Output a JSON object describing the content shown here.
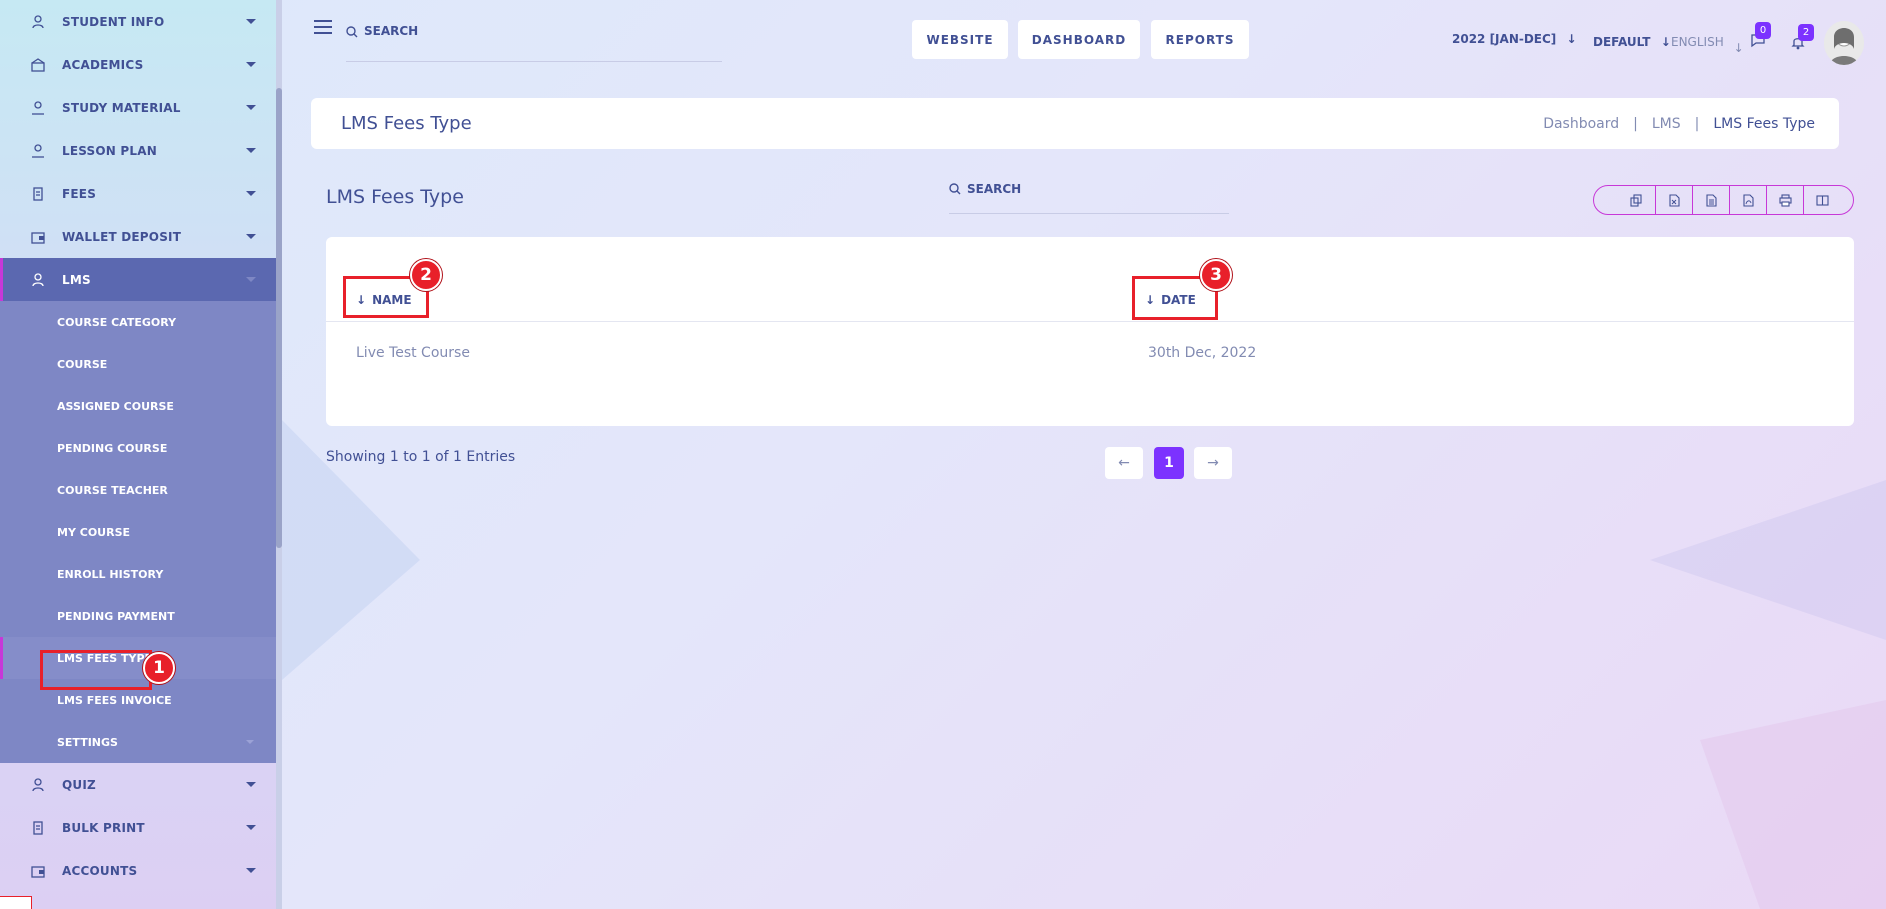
{
  "sidebar": {
    "items_top": [
      {
        "label": "STUDENT INFO",
        "icon": "student-icon"
      },
      {
        "label": "ACADEMICS",
        "icon": "academics-icon"
      },
      {
        "label": "STUDY MATERIAL",
        "icon": "study-icon"
      },
      {
        "label": "LESSON PLAN",
        "icon": "lesson-icon"
      },
      {
        "label": "FEES",
        "icon": "fees-icon"
      },
      {
        "label": "WALLET DEPOSIT",
        "icon": "wallet-icon"
      }
    ],
    "active_item": {
      "label": "LMS",
      "icon": "lms-icon"
    },
    "submenu": [
      "COURSE CATEGORY",
      "COURSE",
      "ASSIGNED COURSE",
      "PENDING COURSE",
      "COURSE TEACHER",
      "MY COURSE",
      "ENROLL HISTORY",
      "PENDING PAYMENT",
      "LMS FEES TYPE",
      "LMS FEES INVOICE",
      "SETTINGS"
    ],
    "items_bottom": [
      {
        "label": "QUIZ",
        "icon": "quiz-icon"
      },
      {
        "label": "BULK PRINT",
        "icon": "print-icon"
      },
      {
        "label": "ACCOUNTS",
        "icon": "accounts-icon"
      }
    ]
  },
  "topbar": {
    "search_placeholder": "SEARCH",
    "buttons": [
      "WEBSITE",
      "DASHBOARD",
      "REPORTS"
    ],
    "session": "2022 [JAN-DEC]",
    "theme": "DEFAULT",
    "language": "ENGLISH",
    "messages_count": "0",
    "notifications_count": "2"
  },
  "page": {
    "title": "LMS Fees Type",
    "breadcrumb": [
      "Dashboard",
      "|",
      "LMS",
      "|",
      "LMS Fees Type"
    ],
    "section_title": "LMS Fees Type",
    "table_search_placeholder": "SEARCH"
  },
  "table": {
    "columns": [
      "NAME",
      "DATE"
    ],
    "rows": [
      {
        "name": "Live Test Course",
        "date": "30th Dec, 2022"
      }
    ]
  },
  "footer": {
    "entries": "Showing 1 to 1 of 1 Entries",
    "prev": "←",
    "current_page": "1",
    "next": "→"
  },
  "markers": [
    "1",
    "2",
    "3"
  ],
  "colors": {
    "accent": "#7c32ff",
    "primary_text": "#415094",
    "highlight": "#e8202a",
    "sidebar_active": "#5b68b0",
    "submenu_bg": "#7e87c5"
  }
}
